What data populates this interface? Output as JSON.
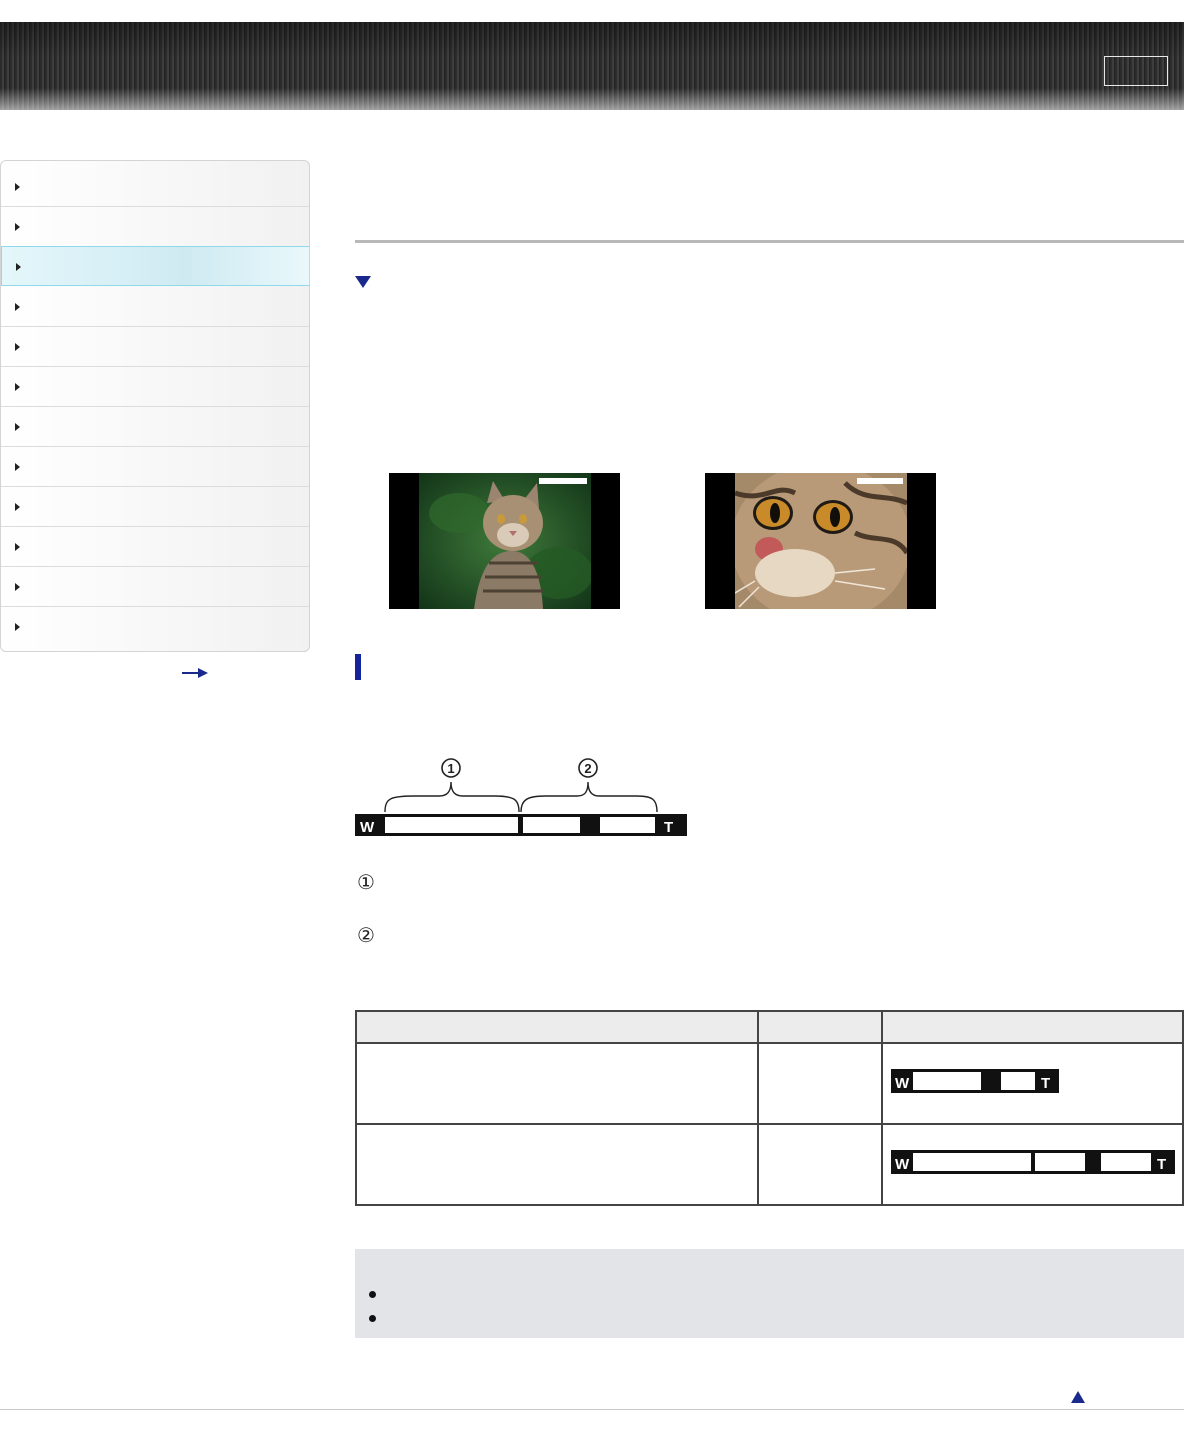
{
  "header": {
    "button_label": ""
  },
  "sidebar": {
    "items": [
      {
        "label": "",
        "active": false
      },
      {
        "label": "",
        "active": false
      },
      {
        "label": "",
        "active": true
      },
      {
        "label": "",
        "active": false
      },
      {
        "label": "",
        "active": false
      },
      {
        "label": "",
        "active": false
      },
      {
        "label": "",
        "active": false
      },
      {
        "label": "",
        "active": false
      },
      {
        "label": "",
        "active": false
      },
      {
        "label": "",
        "active": false
      },
      {
        "label": "",
        "active": false
      },
      {
        "label": "",
        "active": false
      }
    ],
    "more_icon": "arrow-right-icon"
  },
  "colors": {
    "accent": "#1a2a8c",
    "section_bar": "#14249a",
    "active_nav": "#cfeaf2",
    "note_bg": "#e2e4e8"
  },
  "zoom_diagram": {
    "wide_label": "W",
    "tele_label": "T",
    "markers": [
      "①",
      "②"
    ]
  },
  "legend": {
    "items": [
      {
        "marker": "①",
        "text": ""
      },
      {
        "marker": "②",
        "text": ""
      }
    ]
  },
  "table": {
    "headers": [
      "",
      "",
      ""
    ],
    "rows": [
      {
        "cells": [
          "",
          ""
        ],
        "indicator": {
          "wide_label": "W",
          "tele_label": "T"
        }
      },
      {
        "cells": [
          "",
          ""
        ],
        "indicator": {
          "wide_label": "W",
          "tele_label": "T"
        }
      }
    ]
  },
  "note": {
    "items": [
      "",
      ""
    ]
  },
  "icons": {
    "expand": "triangle-down-icon",
    "to_top": "triangle-up-icon"
  }
}
